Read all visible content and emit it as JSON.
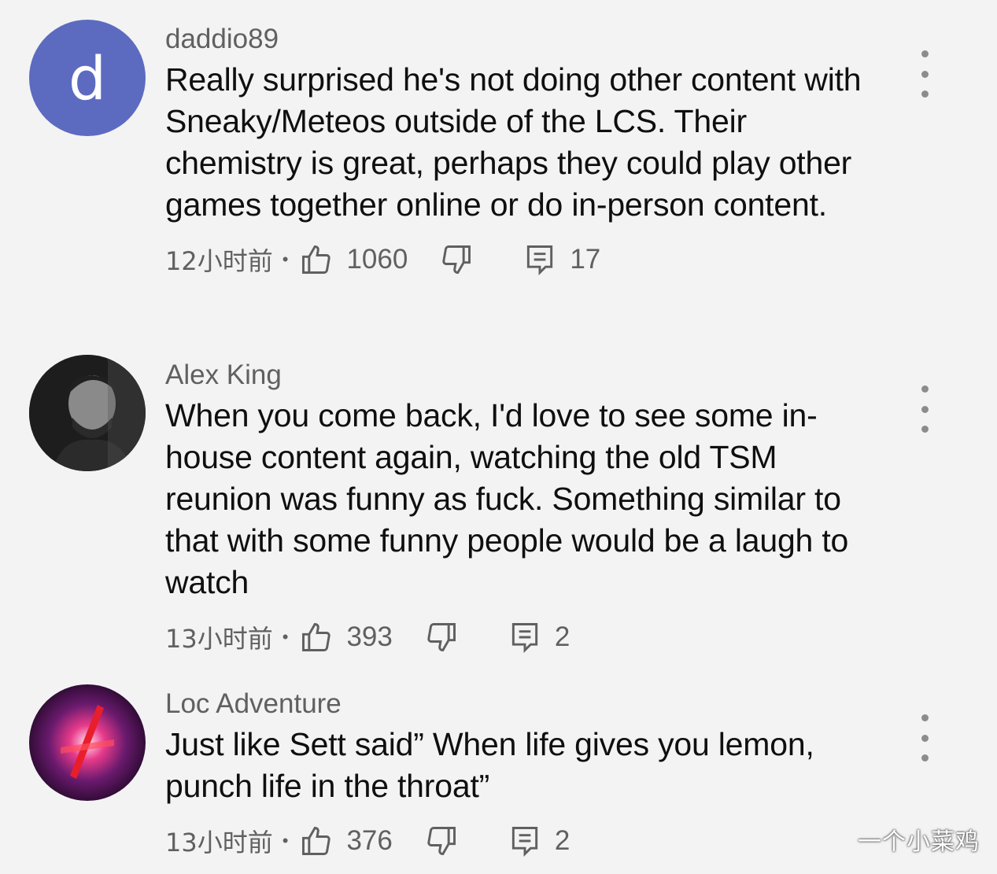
{
  "comments": [
    {
      "avatar_letter": "d",
      "author": "daddio89",
      "text": "Really surprised he's not doing other content with Sneaky/Meteos outside of the LCS. Their chemistry is great, perhaps they could play other games together online or do in-person content.",
      "time": "12小时前",
      "separator": "•",
      "likes": "1060",
      "replies": "17"
    },
    {
      "author": "Alex King",
      "text": "When you come back, I'd love to see some in-house content again, watching the old TSM reunion was funny as fuck. Something similar to that with some funny people would be a laugh to watch",
      "time": "13小时前",
      "separator": "•",
      "likes": "393",
      "replies": "2"
    },
    {
      "author": "Loc Adventure",
      "text": "Just like Sett said” When life gives you lemon, punch life in the throat”",
      "time": "13小时前",
      "separator": "•",
      "likes": "376",
      "replies": "2"
    }
  ],
  "icons": {
    "like": "thumbs-up-icon",
    "dislike": "thumbs-down-icon",
    "reply": "reply-comment-icon",
    "menu": "more-vertical-icon"
  },
  "colors": {
    "avatar_letter_bg": "#5c6bc0",
    "background": "#f3f3f3"
  },
  "watermark": "一个小菜鸡"
}
